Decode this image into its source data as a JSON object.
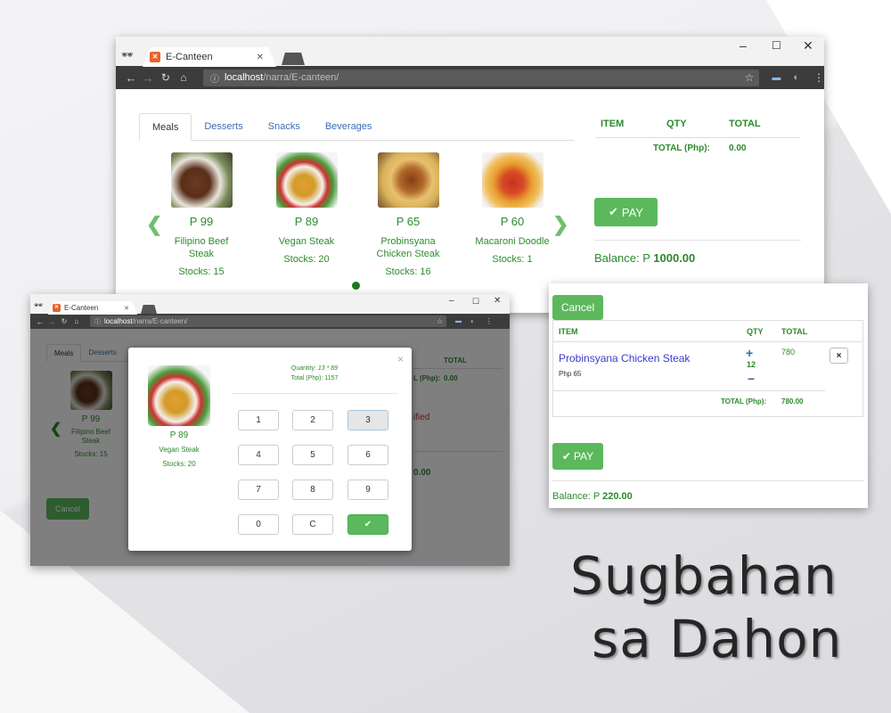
{
  "main": {
    "tab_title": "E-Canteen",
    "url_host": "localhost",
    "url_path": "/narra/E-canteen/",
    "tabs": [
      "Meals",
      "Desserts",
      "Snacks",
      "Beverages"
    ],
    "foods": [
      {
        "price": "P 99",
        "name": "Filipino Beef Steak",
        "stock": "Stocks: 15"
      },
      {
        "price": "P 89",
        "name": "Vegan Steak",
        "stock": "Stocks: 20"
      },
      {
        "price": "P 65",
        "name": "Probinsyana Chicken Steak",
        "stock": "Stocks: 16"
      },
      {
        "price": "P 60",
        "name": "Macaroni Doodle",
        "stock": "Stocks: 1"
      }
    ],
    "order_headers": {
      "item": "ITEM",
      "qty": "QTY",
      "total": "TOTAL"
    },
    "total_label": "TOTAL (Php):",
    "total_value": "0.00",
    "pay_label": "PAY",
    "balance_label": "Balance: P",
    "balance_value": "1000.00"
  },
  "second": {
    "tab_title": "E-Canteen",
    "url_host": "localhost",
    "url_path": "/narra/E-canteen/",
    "tabs": [
      "Meals",
      "Desserts"
    ],
    "food": {
      "price": "P 99",
      "name": "Filipino Beef Steak",
      "stock": "Stocks: 15"
    },
    "cancel_label": "Cancel",
    "behind_total_header": "TOTAL",
    "behind_total_label": "L (Php):",
    "behind_total_value": "0.00",
    "behind_warning": "ified",
    "behind_amount": "0.00",
    "modal": {
      "quantity_label": "Quantity:",
      "quantity_value": "13 *  89",
      "total_label": "Total (Php):",
      "total_value": "1157",
      "food_price": "P 89",
      "food_name": "Vegan Steak",
      "food_stock": "Stocks: 20",
      "close": "×",
      "keys": [
        "1",
        "2",
        "3",
        "4",
        "5",
        "6",
        "7",
        "8",
        "9",
        "0",
        "C",
        "✔"
      ]
    }
  },
  "cart": {
    "cancel_label": "Cancel",
    "headers": {
      "item": "ITEM",
      "qty": "QTY",
      "total": "TOTAL"
    },
    "item_name": "Probinsyana Chicken Steak",
    "item_price": "Php 65",
    "item_qty": "12",
    "item_total": "780",
    "remove": "×",
    "total_label": "TOTAL (Php):",
    "total_value": "780.00",
    "pay_label": "PAY",
    "balance_label": "Balance: P",
    "balance_value": "220.00"
  },
  "title_line1": "Sugbahan",
  "title_line2": "sa Dahon",
  "colors": {
    "accent_green": "#5cb85c",
    "text_green": "#2b8a2b",
    "link_blue": "#3a6fb5"
  }
}
